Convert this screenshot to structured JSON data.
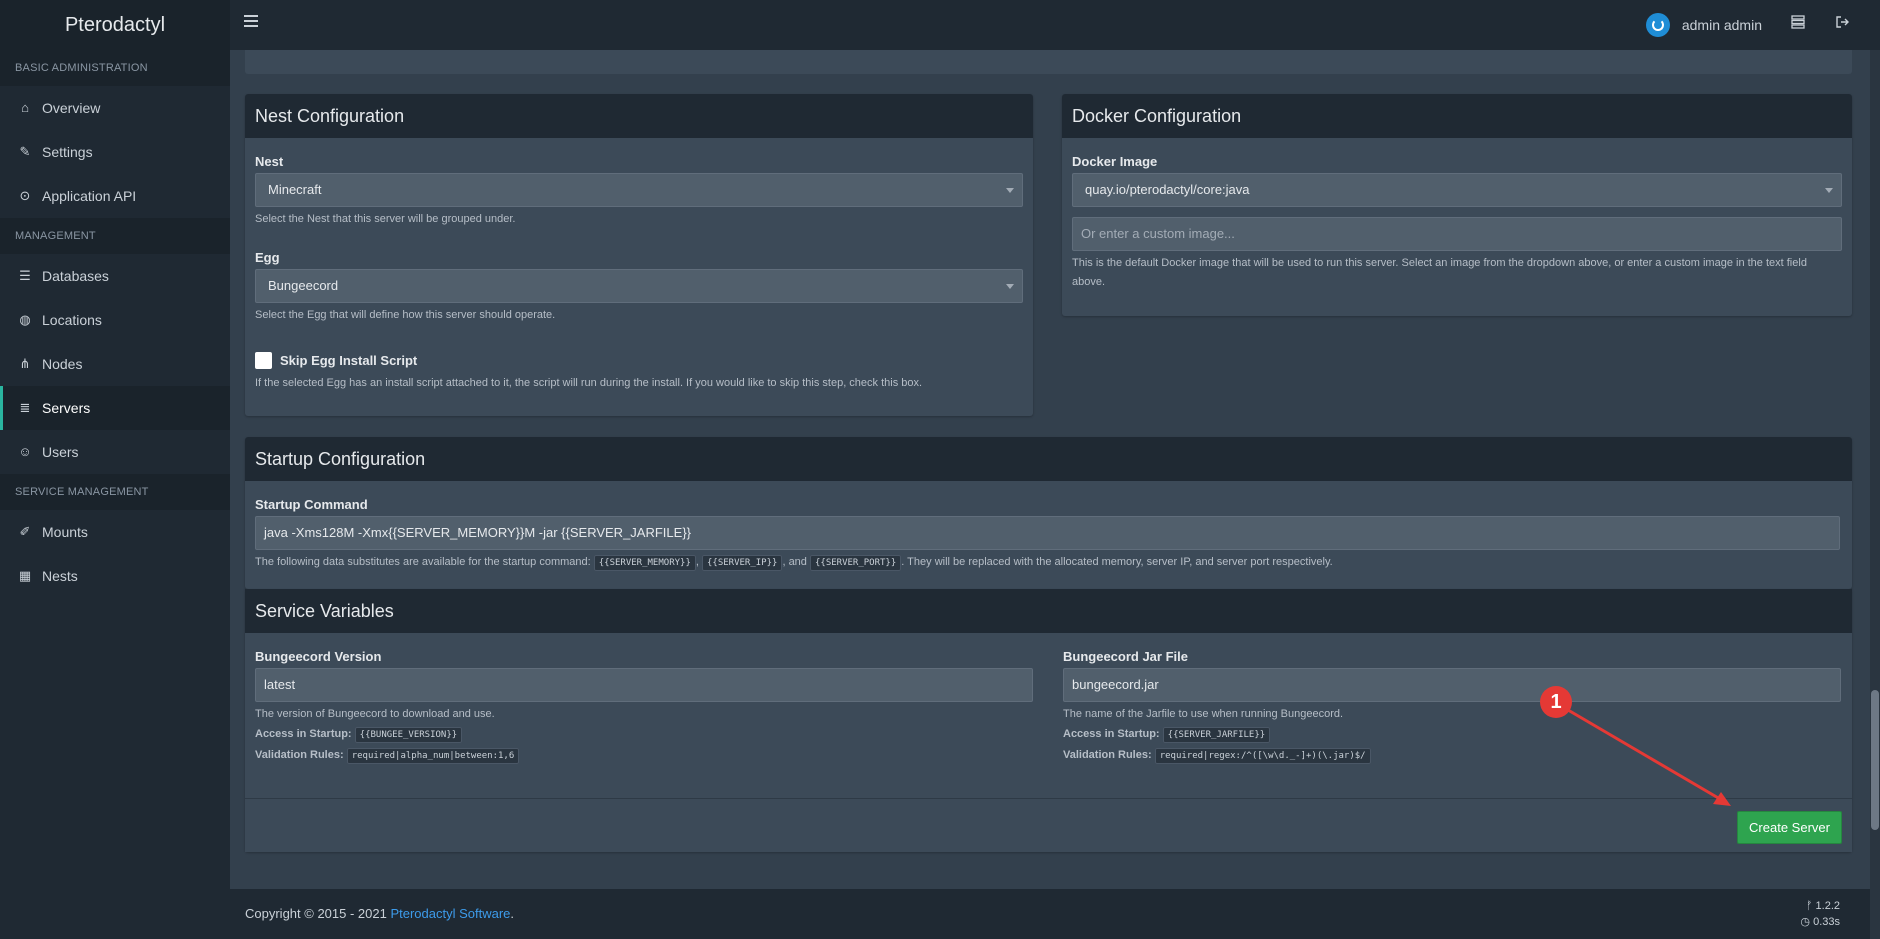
{
  "app": {
    "brand": "Pterodactyl",
    "user_name": "admin admin"
  },
  "icons": {
    "menu": "hamburger-icon",
    "user": "power-avatar-icon",
    "servers": "server-stack-icon",
    "logout": "sign-out-icon"
  },
  "sidebar": {
    "sections": [
      {
        "header": "BASIC ADMINISTRATION",
        "items": [
          {
            "label": "Overview",
            "icon": "⌂"
          },
          {
            "label": "Settings",
            "icon": "✎"
          },
          {
            "label": "Application API",
            "icon": "⊙"
          }
        ]
      },
      {
        "header": "MANAGEMENT",
        "items": [
          {
            "label": "Databases",
            "icon": "☰"
          },
          {
            "label": "Locations",
            "icon": "◍"
          },
          {
            "label": "Nodes",
            "icon": "⋔"
          },
          {
            "label": "Servers",
            "icon": "≣"
          },
          {
            "label": "Users",
            "icon": "☺"
          }
        ]
      },
      {
        "header": "SERVICE MANAGEMENT",
        "items": [
          {
            "label": "Mounts",
            "icon": "✐"
          },
          {
            "label": "Nests",
            "icon": "▦"
          }
        ]
      }
    ]
  },
  "nest_config": {
    "title": "Nest Configuration",
    "nest_label": "Nest",
    "nest_value": "Minecraft",
    "nest_help": "Select the Nest that this server will be grouped under.",
    "egg_label": "Egg",
    "egg_value": "Bungeecord",
    "egg_help": "Select the Egg that will define how this server should operate.",
    "skip_label": "Skip Egg Install Script",
    "skip_help": "If the selected Egg has an install script attached to it, the script will run during the install. If you would like to skip this step, check this box."
  },
  "docker_config": {
    "title": "Docker Configuration",
    "image_label": "Docker Image",
    "image_value": "quay.io/pterodactyl/core:java",
    "custom_placeholder": "Or enter a custom image...",
    "help_line1": "This is the default Docker image that will be used to run this server. Select an image from the dropdown above, or enter a custom image in the text field",
    "help_line2": "above."
  },
  "startup": {
    "title": "Startup Configuration",
    "command_label": "Startup Command",
    "command_value": "java -Xms128M -Xmx{{SERVER_MEMORY}}M -jar {{SERVER_JARFILE}}",
    "help_prefix": "The following data substitutes are available for the startup command:",
    "var_memory": "{{SERVER_MEMORY}}",
    "var_ip": "{{SERVER_IP}}",
    "var_port": "{{SERVER_PORT}}",
    "help_and": ", and",
    "help_suffix": ". They will be replaced with the allocated memory, server IP, and server port respectively."
  },
  "service_vars": {
    "title": "Service Variables",
    "access_label": "Access in Startup:",
    "rules_label": "Validation Rules:",
    "vars": [
      {
        "label": "Bungeecord Version",
        "value": "latest",
        "desc": "The version of Bungeecord to download and use.",
        "access": "{{BUNGEE_VERSION}}",
        "rules": "required|alpha_num|between:1,6"
      },
      {
        "label": "Bungeecord Jar File",
        "value": "bungeecord.jar",
        "desc": "The name of the Jarfile to use when running Bungeecord.",
        "access": "{{SERVER_JARFILE}}",
        "rules": "required|regex:/^([\\w\\d._-]+)(\\.jar)$/"
      }
    ]
  },
  "create_button": "Create Server",
  "annotation": "1",
  "footer": {
    "copyright": "Copyright © 2015 - 2021",
    "company": "Pterodactyl Software",
    "dot": ".",
    "version": "1.2.2",
    "time": "0.33s"
  },
  "colors": {
    "accent": "#2ab5a0",
    "button": "#2ea44f",
    "annotation": "#e53935",
    "link": "#3d9bea"
  }
}
